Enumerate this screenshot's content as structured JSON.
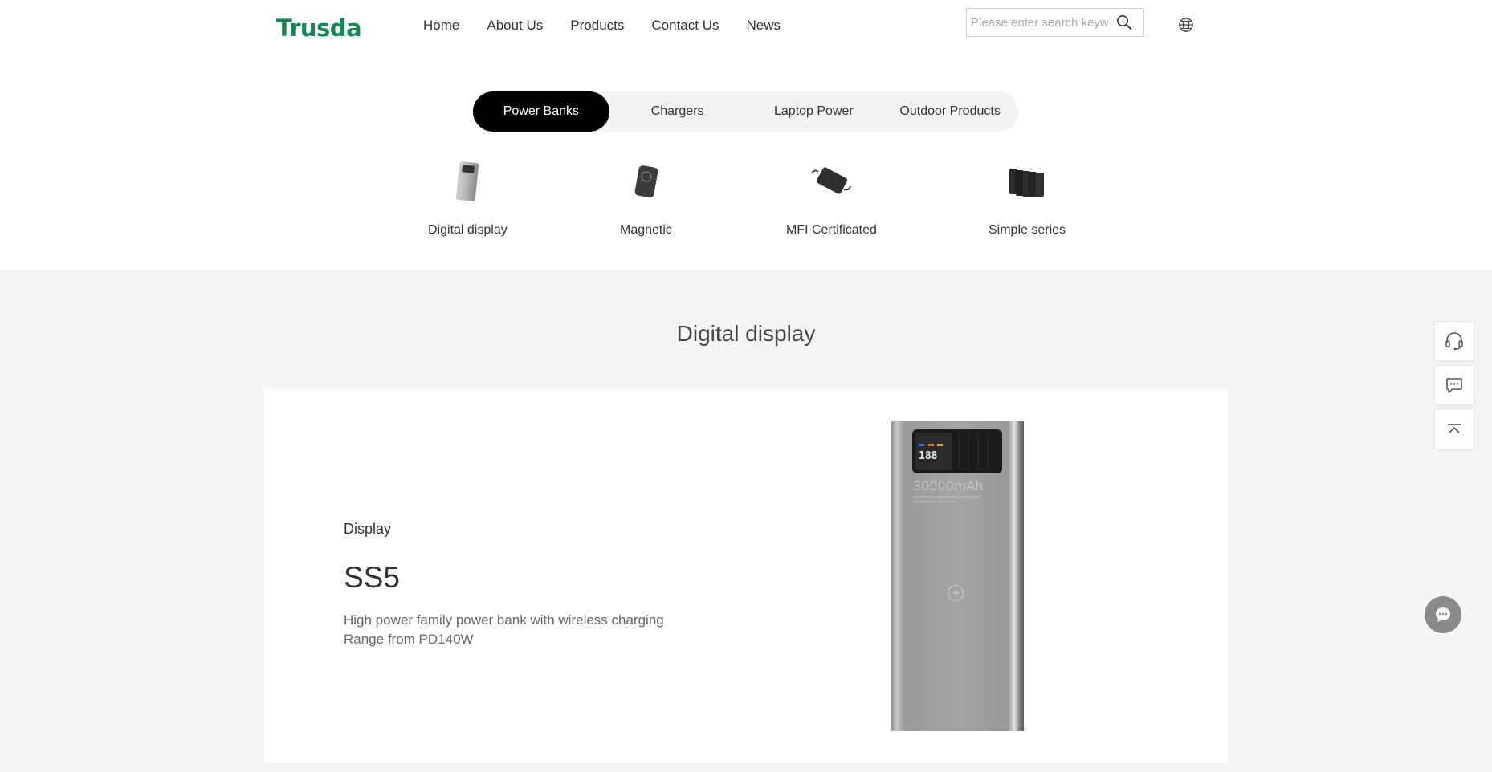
{
  "header": {
    "logo": "Trusda",
    "nav": [
      "Home",
      "About Us",
      "Products",
      "Contact Us",
      "News"
    ],
    "search_placeholder": "Please enter search keywords",
    "icons": {
      "search": "search-icon",
      "language": "globe-icon"
    }
  },
  "category_tabs": {
    "items": [
      "Power Banks",
      "Chargers",
      "Laptop Power",
      "Outdoor Products"
    ],
    "active": "Power Banks"
  },
  "subcategories": [
    {
      "label": "Digital display"
    },
    {
      "label": "Magnetic"
    },
    {
      "label": "MFI Certificated"
    },
    {
      "label": "Simple series"
    }
  ],
  "section": {
    "title": "Digital display"
  },
  "product": {
    "category": "Display",
    "model": "SS5",
    "description_lines": [
      "High power family power bank with wireless charging",
      "Range from PD140W"
    ],
    "image_text": {
      "capacity": "30000mAh",
      "display": "188"
    }
  },
  "floating_tools": [
    "headset-icon",
    "message-icon",
    "back-to-top-icon"
  ],
  "chat": {
    "icon": "chat-bubble-icon"
  },
  "colors": {
    "brand": "#0f8a4f",
    "active_tab": "#000000",
    "section_bg": "#f4f5f4"
  }
}
